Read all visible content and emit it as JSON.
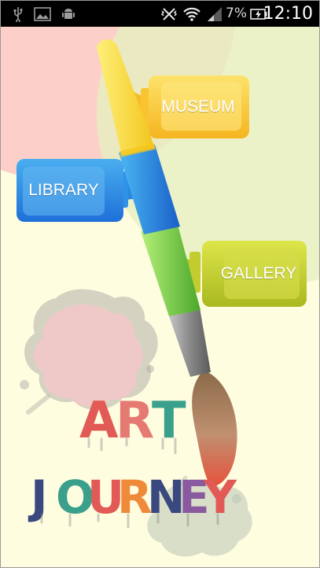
{
  "status_bar": {
    "time": "12:10",
    "battery_percent": "7%",
    "icons": [
      "usb-icon",
      "image-icon",
      "android-debug-icon",
      "vibrate-icon",
      "wifi-icon",
      "signal-icon",
      "battery-charging-icon"
    ]
  },
  "nav": {
    "museum_label": "MUSEUM",
    "library_label": "LIBRARY",
    "gallery_label": "GALLERY"
  },
  "title": {
    "line1": [
      "A",
      "R",
      "T"
    ],
    "line2": [
      "J",
      "O",
      "U",
      "R",
      "N",
      "E",
      "Y"
    ]
  },
  "colors": {
    "background": "#fffde0",
    "pink_circle": "#fcc8c4",
    "green_circle": "#e6efc0",
    "museum": "#f8c530",
    "library": "#2e93e6",
    "gallery": "#c8d234",
    "title_red": "#e0504c",
    "title_teal": "#3aa08c",
    "title_navy": "#3a4880",
    "title_orange": "#ef8a3a",
    "title_purple": "#8a5aa0"
  }
}
